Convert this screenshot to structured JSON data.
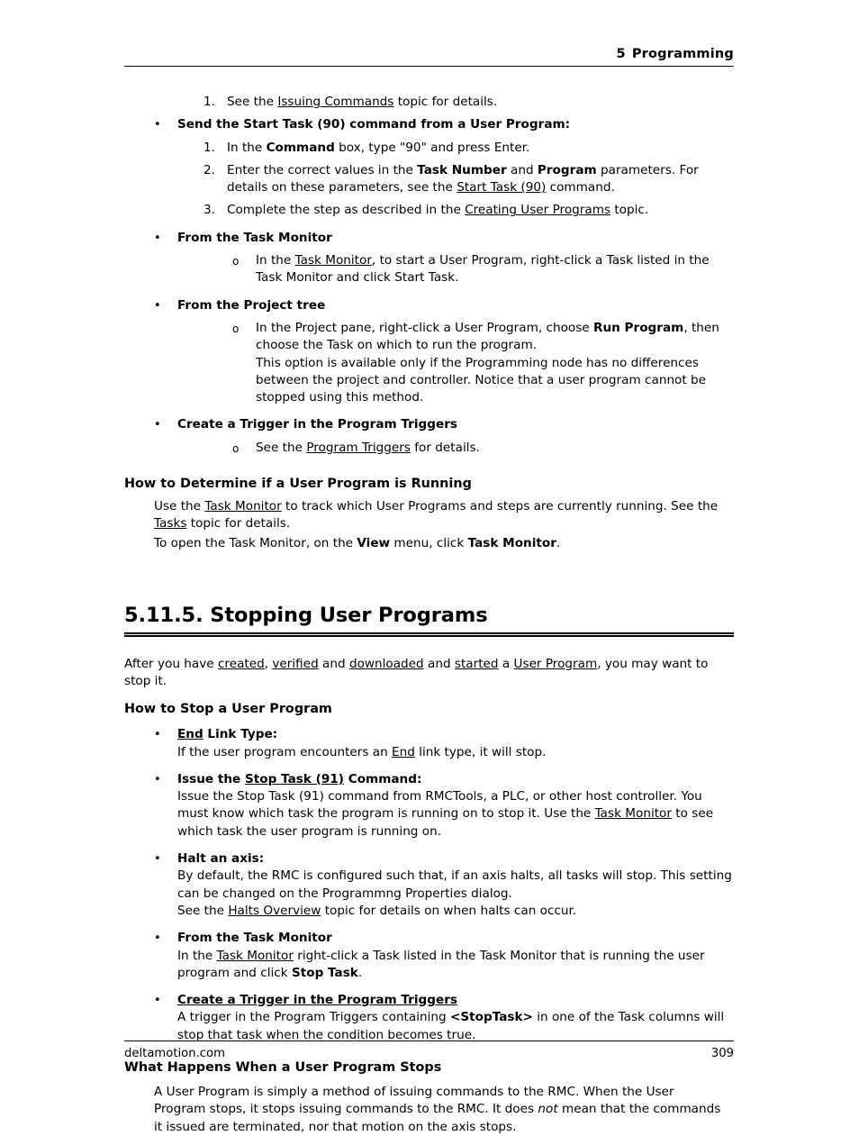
{
  "header": {
    "chapter_number": "5",
    "chapter_title": "Programming"
  },
  "footer": {
    "site": "deltamotion.com",
    "page_number": "309"
  },
  "top_list": {
    "item1_marker": "1.",
    "item1_pre": "See the ",
    "item1_link": "Issuing Commands",
    "item1_post": " topic for details.",
    "bullet_send": {
      "marker": "•",
      "label": "Send the Start Task (90) command from a User Program:",
      "steps": [
        {
          "marker": "1.",
          "pre": "In the ",
          "bold": "Command",
          "post": " box, type \"90\" and press Enter."
        },
        {
          "marker": "2.",
          "pre": "Enter the correct values in the ",
          "bold": "Task Number",
          "mid": " and ",
          "bold2": "Program",
          "post": " parameters. For details on these parameters, see the ",
          "link": "Start Task (90)",
          "tail": " command."
        },
        {
          "marker": "3.",
          "pre": "Complete the step as described in the ",
          "link": "Creating User Programs",
          "post": " topic."
        }
      ]
    },
    "bullet_task_monitor": {
      "marker": "•",
      "label": "From the Task Monitor",
      "sub_marker": "o",
      "sub_pre": "In the ",
      "sub_link": "Task Monitor",
      "sub_post": ", to start a User Program, right-click a Task listed in the Task Monitor and click Start Task."
    },
    "bullet_project_tree": {
      "marker": "•",
      "label": "From the Project tree",
      "sub_marker": "o",
      "sub_pre": "In the Project pane, right-click a User Program, choose ",
      "sub_bold": "Run Program",
      "sub_post": ", then choose the Task on which to run the program.",
      "sub_para2": "This option is available only if the Programming node has no differences between the project and controller. Notice that a user program cannot be stopped using this method."
    },
    "bullet_trigger": {
      "marker": "•",
      "label": "Create a Trigger in the Program Triggers",
      "sub_marker": "o",
      "sub_pre": "See the ",
      "sub_link": "Program Triggers",
      "sub_post": " for details."
    }
  },
  "determine_section": {
    "heading": "How to Determine if a User Program is Running",
    "para1_pre": "Use the ",
    "para1_link1": "Task Monitor",
    "para1_mid": " to track which User Programs and steps are currently running. See the ",
    "para1_link2": "Tasks",
    "para1_post": " topic for details.",
    "para2_pre": "To open the Task Monitor, on the ",
    "para2_bold1": "View",
    "para2_mid": " menu, click ",
    "para2_bold2": "Task Monitor",
    "para2_post": "."
  },
  "stopping_section": {
    "heading": "5.11.5. Stopping User Programs",
    "intro_pre": "After you have ",
    "intro_link1": "created",
    "intro_sep1": ", ",
    "intro_link2": "verified",
    "intro_sep2": " and ",
    "intro_link3": "downloaded",
    "intro_sep3": " and ",
    "intro_link4": "started",
    "intro_sep4": " a ",
    "intro_link5": "User Program",
    "intro_post": ", you may want to stop it."
  },
  "how_to_stop": {
    "heading": "How to Stop a User Program",
    "bullets": [
      {
        "marker": "•",
        "label_bu": "End",
        "label_b": " Link Type:",
        "body_pre": "If the user program encounters an ",
        "body_link": "End",
        "body_post": " link type, it will stop."
      },
      {
        "marker": "•",
        "label_b_pre": "Issue the ",
        "label_bu": "Stop Task (91)",
        "label_b_post": " Command:",
        "body_pre": "Issue the Stop Task (91) command from RMCTools, a PLC, or other host controller. You must know which task the program is running on to stop it. Use the ",
        "body_link": "Task Monitor",
        "body_post": " to see which task the user program is running on."
      },
      {
        "marker": "•",
        "label_b": "Halt an axis:",
        "body_line1": "By default, the RMC is configured such that, if an axis halts, all tasks will stop. This setting can be changed on the Programmng Properties dialog.",
        "body_line2_pre": "See the ",
        "body_line2_link": "Halts Overview",
        "body_line2_post": " topic for details on when halts can occur."
      },
      {
        "marker": "•",
        "label_b": "From the Task Monitor",
        "body_pre": "In the ",
        "body_link": "Task Monitor",
        "body_mid": " right-click a Task listed in the Task Monitor that is running the user program and click ",
        "body_bold": "Stop Task",
        "body_post": "."
      },
      {
        "marker": "•",
        "label_bu": "Create a Trigger in the Program Triggers",
        "body_pre": "A trigger in the Program Triggers containing ",
        "body_bold": "<StopTask>",
        "body_post": " in one of the Task columns will stop that task when the condition becomes true."
      }
    ]
  },
  "what_happens": {
    "heading": "What Happens When a User Program Stops",
    "para_pre": "A User Program is simply a method of issuing commands to the RMC. When the User Program stops, it stops issuing commands to the RMC. It does ",
    "para_italic": "not",
    "para_post": " mean that the commands it issued are terminated, nor that motion on the axis stops."
  }
}
